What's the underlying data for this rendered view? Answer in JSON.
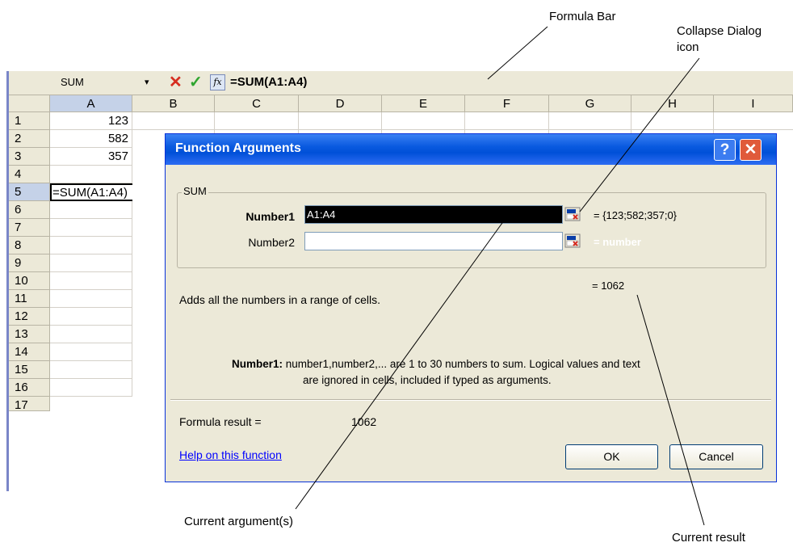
{
  "formula_bar": {
    "name_box": "SUM",
    "dropdown_glyph": "▾",
    "cancel_glyph": "✕",
    "enter_glyph": "✓",
    "fx_glyph": "fx",
    "formula": "=SUM(A1:A4)"
  },
  "columns": [
    "A",
    "B",
    "C",
    "D",
    "E",
    "F",
    "G",
    "H",
    "I"
  ],
  "rows": [
    "1",
    "2",
    "3",
    "4",
    "5",
    "6",
    "7",
    "8",
    "9",
    "10",
    "11",
    "12",
    "13",
    "14",
    "15",
    "16",
    "17"
  ],
  "cells": {
    "a1": "123",
    "a2": "582",
    "a3": "357",
    "a5": "=SUM(A1:A4)"
  },
  "dialog": {
    "title": "Function Arguments",
    "help_glyph": "?",
    "close_glyph": "✕",
    "group_label": "SUM",
    "number1_label": "Number1",
    "number1_value": "A1:A4",
    "number1_result": "= {123;582;357;0}",
    "number2_label": "Number2",
    "number2_value": "",
    "number2_result": "= number",
    "result_line": "= 1062",
    "description": "Adds all the numbers in a range of cells.",
    "help_arg": "Number1:",
    "help_line1": " number1,number2,... are 1 to 30 numbers to sum. Logical values and text",
    "help_line2": "are ignored in cells, included if typed as arguments.",
    "formula_result_label": "Formula result =",
    "formula_result_value": "1062",
    "help_link": "Help on this function",
    "ok_label": "OK",
    "cancel_label": "Cancel"
  },
  "annotations": {
    "formula_bar": "Formula Bar",
    "collapse_dialog": "Collapse Dialog",
    "collapse_dialog_2": "icon",
    "current_arguments": "Current argument(s)",
    "current_result": "Current result"
  },
  "icons": {
    "collapse": "collapse-dialog-icon",
    "cancel": "cancel-x-icon",
    "enter": "check-icon",
    "insert_function": "fx-icon"
  }
}
